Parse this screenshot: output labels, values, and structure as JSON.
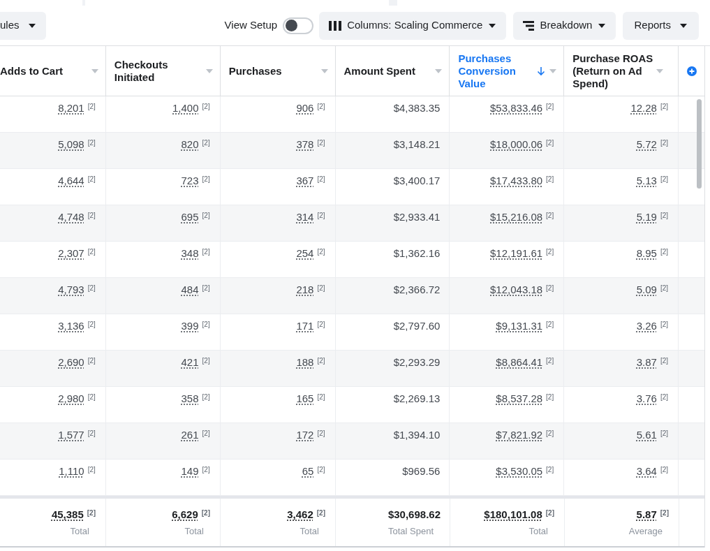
{
  "toolbar": {
    "rules_button": "ules",
    "view_setup": {
      "label": "View Setup",
      "on": false
    },
    "columns_button": "Columns: Scaling Commerce",
    "breakdown_button": "Breakdown",
    "reports_button": "Reports"
  },
  "table": {
    "columns": [
      {
        "label": "Adds to Cart",
        "sorted": false
      },
      {
        "label": "Checkouts Initiated",
        "sorted": false
      },
      {
        "label": "Purchases",
        "sorted": false
      },
      {
        "label": "Amount Spent",
        "sorted": false
      },
      {
        "label": "Purchases Conversion Value",
        "sorted": true
      },
      {
        "label": "Purchase ROAS (Return on Ad Spend)",
        "sorted": false
      }
    ],
    "rows": [
      [
        {
          "value": "8,201",
          "note": "[2]"
        },
        {
          "value": "1,400",
          "note": "[2]"
        },
        {
          "value": "906",
          "note": "[2]"
        },
        {
          "value": "$4,383.35"
        },
        {
          "value": "$53,833.46",
          "note": "[2]"
        },
        {
          "value": "12.28",
          "note": "[2]"
        }
      ],
      [
        {
          "value": "5,098",
          "note": "[2]"
        },
        {
          "value": "820",
          "note": "[2]"
        },
        {
          "value": "378",
          "note": "[2]"
        },
        {
          "value": "$3,148.21"
        },
        {
          "value": "$18,000.06",
          "note": "[2]"
        },
        {
          "value": "5.72",
          "note": "[2]"
        }
      ],
      [
        {
          "value": "4,644",
          "note": "[2]"
        },
        {
          "value": "723",
          "note": "[2]"
        },
        {
          "value": "367",
          "note": "[2]"
        },
        {
          "value": "$3,400.17"
        },
        {
          "value": "$17,433.80",
          "note": "[2]"
        },
        {
          "value": "5.13",
          "note": "[2]"
        }
      ],
      [
        {
          "value": "4,748",
          "note": "[2]"
        },
        {
          "value": "695",
          "note": "[2]"
        },
        {
          "value": "314",
          "note": "[2]"
        },
        {
          "value": "$2,933.41"
        },
        {
          "value": "$15,216.08",
          "note": "[2]"
        },
        {
          "value": "5.19",
          "note": "[2]"
        }
      ],
      [
        {
          "value": "2,307",
          "note": "[2]"
        },
        {
          "value": "348",
          "note": "[2]"
        },
        {
          "value": "254",
          "note": "[2]"
        },
        {
          "value": "$1,362.16"
        },
        {
          "value": "$12,191.61",
          "note": "[2]"
        },
        {
          "value": "8.95",
          "note": "[2]"
        }
      ],
      [
        {
          "value": "4,793",
          "note": "[2]"
        },
        {
          "value": "484",
          "note": "[2]"
        },
        {
          "value": "218",
          "note": "[2]"
        },
        {
          "value": "$2,366.72"
        },
        {
          "value": "$12,043.18",
          "note": "[2]"
        },
        {
          "value": "5.09",
          "note": "[2]"
        }
      ],
      [
        {
          "value": "3,136",
          "note": "[2]"
        },
        {
          "value": "399",
          "note": "[2]"
        },
        {
          "value": "171",
          "note": "[2]"
        },
        {
          "value": "$2,797.60"
        },
        {
          "value": "$9,131.31",
          "note": "[2]"
        },
        {
          "value": "3.26",
          "note": "[2]"
        }
      ],
      [
        {
          "value": "2,690",
          "note": "[2]"
        },
        {
          "value": "421",
          "note": "[2]"
        },
        {
          "value": "188",
          "note": "[2]"
        },
        {
          "value": "$2,293.29"
        },
        {
          "value": "$8,864.41",
          "note": "[2]"
        },
        {
          "value": "3.87",
          "note": "[2]"
        }
      ],
      [
        {
          "value": "2,980",
          "note": "[2]"
        },
        {
          "value": "358",
          "note": "[2]"
        },
        {
          "value": "165",
          "note": "[2]"
        },
        {
          "value": "$2,269.13"
        },
        {
          "value": "$8,537.28",
          "note": "[2]"
        },
        {
          "value": "3.76",
          "note": "[2]"
        }
      ],
      [
        {
          "value": "1,577",
          "note": "[2]"
        },
        {
          "value": "261",
          "note": "[2]"
        },
        {
          "value": "172",
          "note": "[2]"
        },
        {
          "value": "$1,394.10"
        },
        {
          "value": "$7,821.92",
          "note": "[2]"
        },
        {
          "value": "5.61",
          "note": "[2]"
        }
      ],
      [
        {
          "value": "1,110",
          "note": "[2]"
        },
        {
          "value": "149",
          "note": "[2]"
        },
        {
          "value": "65",
          "note": "[2]"
        },
        {
          "value": "$969.56"
        },
        {
          "value": "$3,530.05",
          "note": "[2]"
        },
        {
          "value": "3.64",
          "note": "[2]"
        }
      ]
    ],
    "totals": [
      {
        "value": "45,385",
        "note": "[2]",
        "label": "Total"
      },
      {
        "value": "6,629",
        "note": "[2]",
        "label": "Total"
      },
      {
        "value": "3,462",
        "note": "[2]",
        "label": "Total"
      },
      {
        "value": "$30,698.62",
        "label": "Total Spent"
      },
      {
        "value": "$180,101.08",
        "note": "[2]",
        "label": "Total"
      },
      {
        "value": "5.87",
        "note": "[2]",
        "label": "Average"
      }
    ]
  }
}
